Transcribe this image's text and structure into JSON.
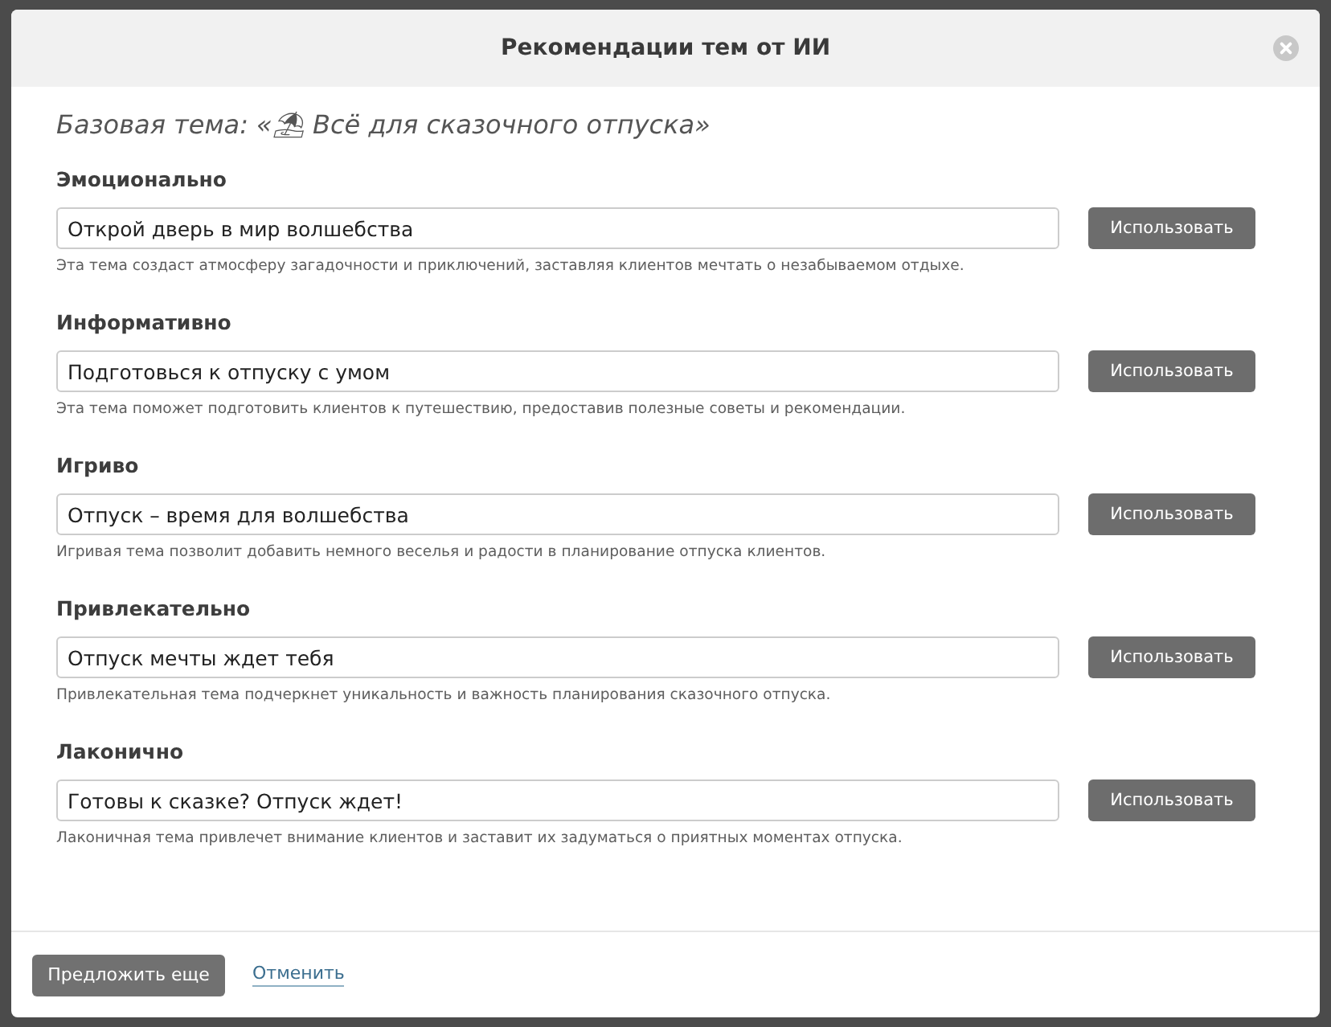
{
  "dialog": {
    "title": "Рекомендации тем от ИИ"
  },
  "base_theme": "Базовая тема: «⛱ Всё для сказочного отпуска»",
  "suggestions": [
    {
      "tone": "Эмоционально",
      "value": "Открой дверь в мир волшебства",
      "button": "Использовать",
      "description": "Эта тема создаст атмосферу загадочности и приключений, заставляя клиентов мечтать о незабываемом отдыхе."
    },
    {
      "tone": "Информативно",
      "value": "Подготовься к отпуску с умом",
      "button": "Использовать",
      "description": "Эта тема поможет подготовить клиентов к путешествию, предоставив полезные советы и рекомендации."
    },
    {
      "tone": "Игриво",
      "value": "Отпуск – время для волшебства",
      "button": "Использовать",
      "description": "Игривая тема позволит добавить немного веселья и радости в планирование отпуска клиентов."
    },
    {
      "tone": "Привлекательно",
      "value": "Отпуск мечты ждет тебя",
      "button": "Использовать",
      "description": "Привлекательная тема подчеркнет уникальность и важность планирования сказочного отпуска."
    },
    {
      "tone": "Лаконично",
      "value": "Готовы к сказке? Отпуск ждет!",
      "button": "Использовать",
      "description": "Лаконичная тема привлечет внимание клиентов и заставит их задуматься о приятных моментах отпуска."
    }
  ],
  "footer": {
    "primary_button": "Предложить еще",
    "cancel_link": "Отменить"
  }
}
